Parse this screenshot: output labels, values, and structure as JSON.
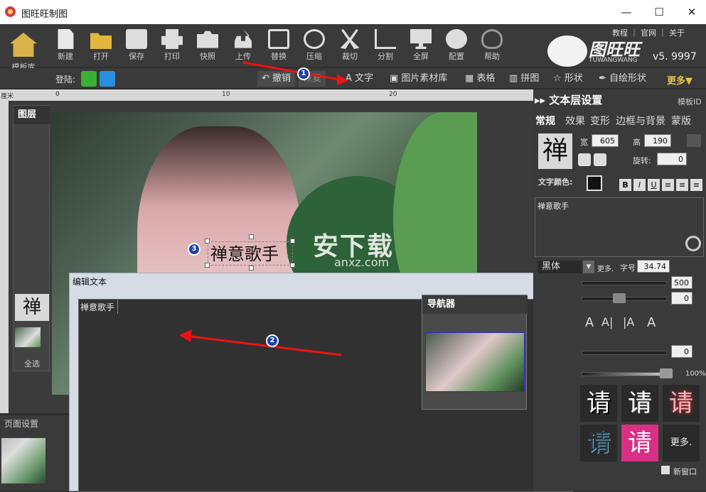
{
  "app": {
    "title": "图旺旺制图"
  },
  "window": {
    "min": "—",
    "max": "☐",
    "close": "✕"
  },
  "toolbar": {
    "home": "模板库",
    "buttons": [
      "新建",
      "打开",
      "保存",
      "打印",
      "快照",
      "上传",
      "替换",
      "压缩",
      "裁切",
      "分割",
      "全屏",
      "配置",
      "帮助"
    ]
  },
  "menu": {
    "links": "教程 ｜ 官网 ｜ 关于"
  },
  "logo": {
    "text": "图旺旺",
    "sub": "TUWANGWANG",
    "version": "v5. 9997"
  },
  "row2": {
    "login": "登陆:",
    "undo": "撤销",
    "redo": "恢复",
    "tools": [
      "文字",
      "图片素材库",
      "表格",
      "拼图",
      "形状",
      "自绘形状"
    ],
    "more": "更多▼"
  },
  "ruler": {
    "unit": "厘米",
    "marks": [
      "0",
      "10",
      "20"
    ]
  },
  "layers": {
    "title": "图层",
    "text_layer": "禅",
    "select_all": "全选"
  },
  "canvas": {
    "text": "禅意歌手",
    "watermark": "安下载",
    "watermark_sub": "anxz.com"
  },
  "badges": {
    "one": "1",
    "two": "2",
    "three": "3"
  },
  "page_settings": {
    "title": "页面设置"
  },
  "dialog": {
    "title": "编辑文本",
    "text": "禅意歌手"
  },
  "navigator": {
    "title": "导航器"
  },
  "right_panel": {
    "header": "文本层设置",
    "template_id": "模板ID",
    "tabs": [
      "常规",
      "效果",
      "变形",
      "边框与背景",
      "蒙版"
    ],
    "preview_char": "禅",
    "width_label": "宽",
    "width": "605",
    "height_label": "高",
    "height": "190",
    "rotate_label": "旋转:",
    "rotate": "0",
    "color_label": "文字颜色:",
    "text": "禅意歌手",
    "font": "黑体",
    "font_more": "更多.",
    "size_label": "字号",
    "size": "34.74",
    "v500": "500",
    "v0a": "0",
    "v0b": "0",
    "pct": "100%",
    "style_char": "请",
    "style_more": "更多.",
    "new_window": "新窗口"
  }
}
